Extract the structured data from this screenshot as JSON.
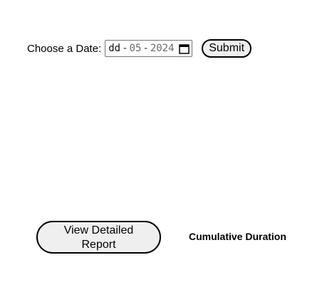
{
  "date_picker": {
    "label": "Choose a Date:",
    "day_placeholder": "dd",
    "separator": "-",
    "month": "05",
    "year": "2024",
    "icon": "calendar-icon"
  },
  "submit": {
    "label": "Submit"
  },
  "report": {
    "button_label": "View Detailed Report",
    "cumulative_label": "Cumulative Duration"
  }
}
